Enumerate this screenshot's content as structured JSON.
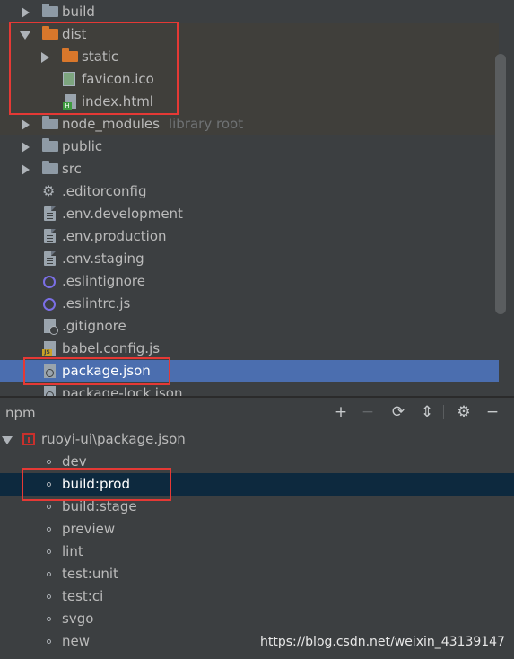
{
  "tree": {
    "items": [
      {
        "label": "build",
        "suffix": ""
      },
      {
        "label": "dist",
        "suffix": ""
      },
      {
        "label": "static",
        "suffix": ""
      },
      {
        "label": "favicon.ico",
        "suffix": ""
      },
      {
        "label": "index.html",
        "suffix": ""
      },
      {
        "label": "node_modules",
        "suffix": "library root"
      },
      {
        "label": "public",
        "suffix": ""
      },
      {
        "label": "src",
        "suffix": ""
      },
      {
        "label": ".editorconfig",
        "suffix": ""
      },
      {
        "label": ".env.development",
        "suffix": ""
      },
      {
        "label": ".env.production",
        "suffix": ""
      },
      {
        "label": ".env.staging",
        "suffix": ""
      },
      {
        "label": ".eslintignore",
        "suffix": ""
      },
      {
        "label": ".eslintrc.js",
        "suffix": ""
      },
      {
        "label": ".gitignore",
        "suffix": ""
      },
      {
        "label": "babel.config.js",
        "suffix": ""
      },
      {
        "label": "package.json",
        "suffix": ""
      },
      {
        "label": "package-lock.json",
        "suffix": ""
      }
    ]
  },
  "npm": {
    "title": "npm",
    "toolbar": {
      "add": "+",
      "remove": "−",
      "refresh": "⟳",
      "collapse": "⇕",
      "settings": "⚙",
      "hide": "−"
    },
    "root": "ruoyi-ui\\package.json",
    "scripts": [
      "dev",
      "build:prod",
      "build:stage",
      "preview",
      "lint",
      "test:unit",
      "test:ci",
      "svgo",
      "new"
    ]
  },
  "watermark": "https://blog.csdn.net/weixin_43139147",
  "colors": {
    "tree_selection": "#4b6eaf",
    "npm_selection": "#0d293e",
    "highlight_box": "#e53935",
    "folder_orange": "#d9772b",
    "folder_grey": "#8e9aa5"
  }
}
